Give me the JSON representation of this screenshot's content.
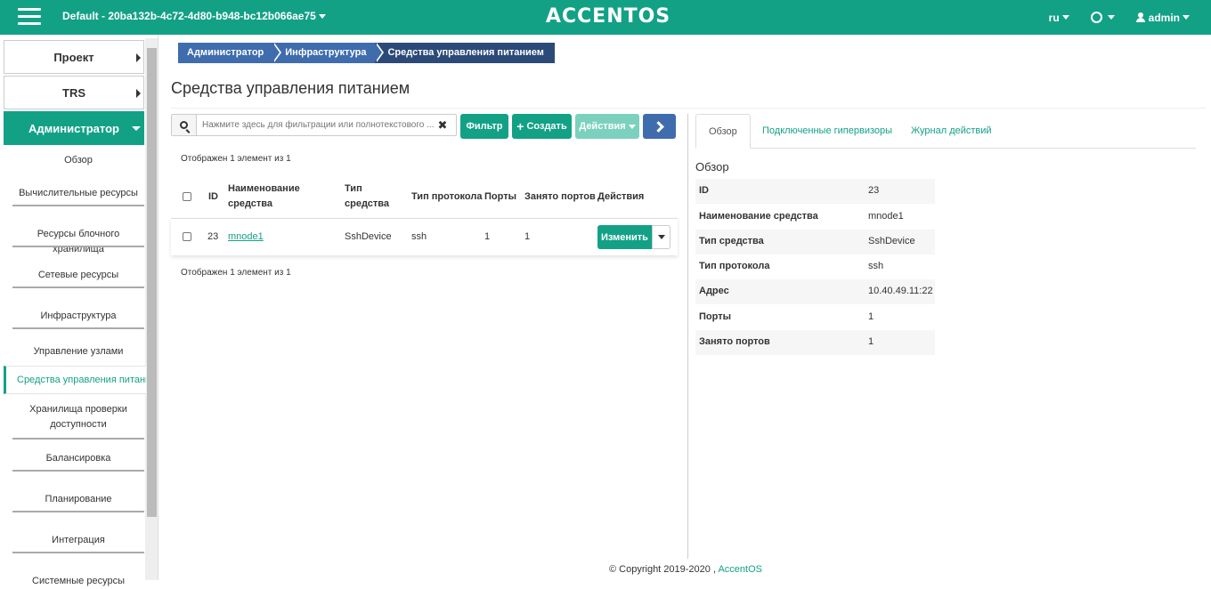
{
  "topbar": {
    "project": "Default - 20ba132b-4c72-4d80-b948-bc12b066ae75",
    "logo": "ACCENTOS",
    "lang": "ru",
    "user": "admin"
  },
  "sidebar": {
    "sections": [
      {
        "label": "Проект"
      },
      {
        "label": "TRS"
      },
      {
        "label": "Администратор"
      }
    ],
    "items": [
      {
        "label": "Обзор"
      },
      {
        "label": "Вычислительные ресурсы"
      },
      {
        "label": "Ресурсы блочного хранилища"
      },
      {
        "label": "Сетевые ресурсы"
      },
      {
        "label": "Инфраструктура"
      },
      {
        "label": "Управление узлами"
      },
      {
        "label": "Средства управления питанием"
      },
      {
        "label": "Хранилища проверки доступности"
      },
      {
        "label": "Балансировка"
      },
      {
        "label": "Планирование"
      },
      {
        "label": "Интеграция"
      },
      {
        "label": "Системные ресурсы"
      }
    ]
  },
  "breadcrumb": [
    "Администратор",
    "Инфраструктура",
    "Средства управления питанием"
  ],
  "page_title": "Средства управления питанием",
  "toolbar": {
    "search_placeholder": "Нажмите здесь для фильтрации или полнотекстового ...",
    "filter": "Фильтр",
    "create": "Создать",
    "actions": "Действия"
  },
  "count_text": "Отображен 1 элемент из 1",
  "table": {
    "headers": {
      "id": "ID",
      "name": "Наименование средства",
      "type": "Тип средства",
      "protocol": "Тип протокола",
      "ports": "Порты",
      "busy": "Занято портов",
      "actions": "Действия"
    },
    "rows": [
      {
        "id": "23",
        "name": "mnode1",
        "type": "SshDevice",
        "protocol": "ssh",
        "ports": "1",
        "busy": "1",
        "action": "Изменить"
      }
    ]
  },
  "detail": {
    "tabs": [
      "Обзор",
      "Подключенные гипервизоры",
      "Журнал действий"
    ],
    "title": "Обзор",
    "rows": [
      {
        "label": "ID",
        "value": "23"
      },
      {
        "label": "Наименование средства",
        "value": "mnode1"
      },
      {
        "label": "Тип средства",
        "value": "SshDevice"
      },
      {
        "label": "Тип протокола",
        "value": "ssh"
      },
      {
        "label": "Адрес",
        "value": "10.40.49.11:22"
      },
      {
        "label": "Порты",
        "value": "1"
      },
      {
        "label": "Занято портов",
        "value": "1"
      }
    ]
  },
  "footer": {
    "copyright": "© Copyright 2019-2020 ,",
    "brand": "AccentOS"
  },
  "colors": {
    "accent": "#13a186",
    "breadcrumb": "#3f6cad",
    "breadcrumb_last": "#2c4a78"
  }
}
